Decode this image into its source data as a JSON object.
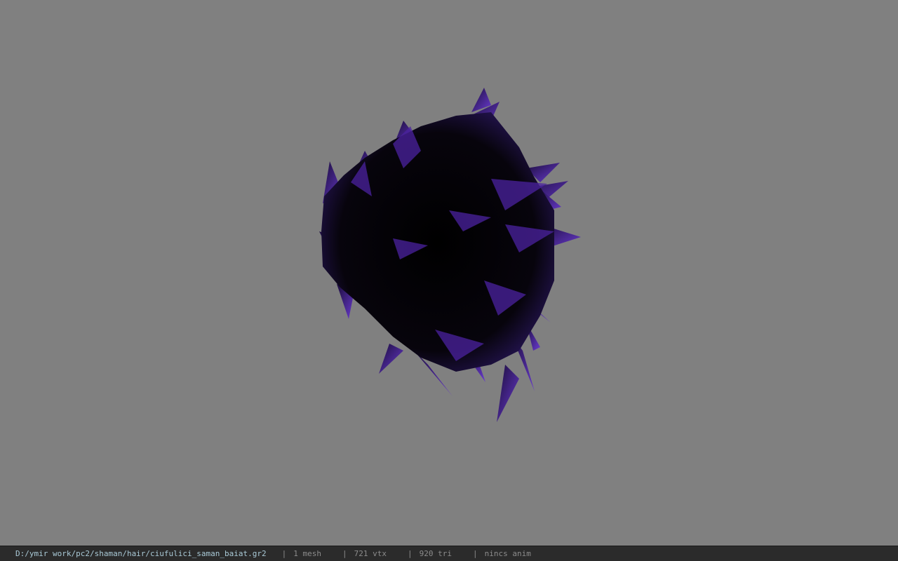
{
  "viewport": {
    "background_color": "#808080",
    "model_icon": "hair-mesh"
  },
  "status": {
    "file_path": "D:/ymir work/pc2/shaman/hair/ciufulici_saman_baiat.gr2",
    "separator": "|",
    "mesh_count": "1 mesh",
    "vertex_count": "721 vtx",
    "triangle_count": "920 tri",
    "anim_status": "nincs anim"
  },
  "colors": {
    "mesh_dark": "#050308",
    "mesh_purple": "#5a2fb0",
    "mesh_violet": "#7a4ad8"
  }
}
